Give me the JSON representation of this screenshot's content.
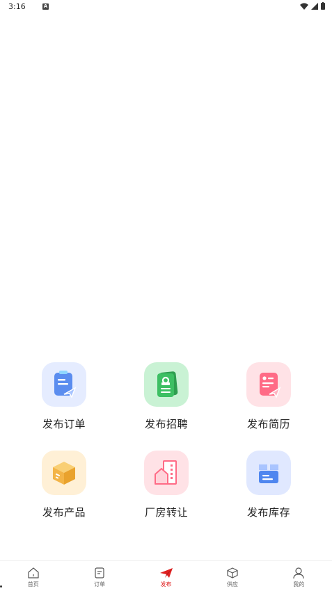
{
  "status": {
    "time": "3:16",
    "notif_icon_letter": "A",
    "icons": [
      "wifi-icon",
      "signal-icon",
      "battery-icon"
    ]
  },
  "menu": [
    {
      "label": "发布订单",
      "icon": "publish-order-icon",
      "bg": "#e5ecff",
      "color": "#5b8def"
    },
    {
      "label": "发布招聘",
      "icon": "publish-recruit-icon",
      "bg": "#c9f2d4",
      "color": "#3dbf63"
    },
    {
      "label": "发布简历",
      "icon": "publish-resume-icon",
      "bg": "#ffe2e6",
      "color": "#ff6b86"
    },
    {
      "label": "发布产品",
      "icon": "publish-product-icon",
      "bg": "#fff0d6",
      "color": "#f3b447"
    },
    {
      "label": "厂房转让",
      "icon": "factory-transfer-icon",
      "bg": "#ffe2e6",
      "color": "#ff6b86"
    },
    {
      "label": "发布库存",
      "icon": "publish-inventory-icon",
      "bg": "#e0e8ff",
      "color": "#4f86ef"
    }
  ],
  "tabs": [
    {
      "label": "首页",
      "icon": "home-icon"
    },
    {
      "label": "订单",
      "icon": "order-icon"
    },
    {
      "label": "发布",
      "icon": "publish-icon",
      "active": true
    },
    {
      "label": "供应",
      "icon": "supply-icon"
    },
    {
      "label": "我的",
      "icon": "profile-icon"
    }
  ],
  "colors": {
    "accent": "#e02020"
  }
}
